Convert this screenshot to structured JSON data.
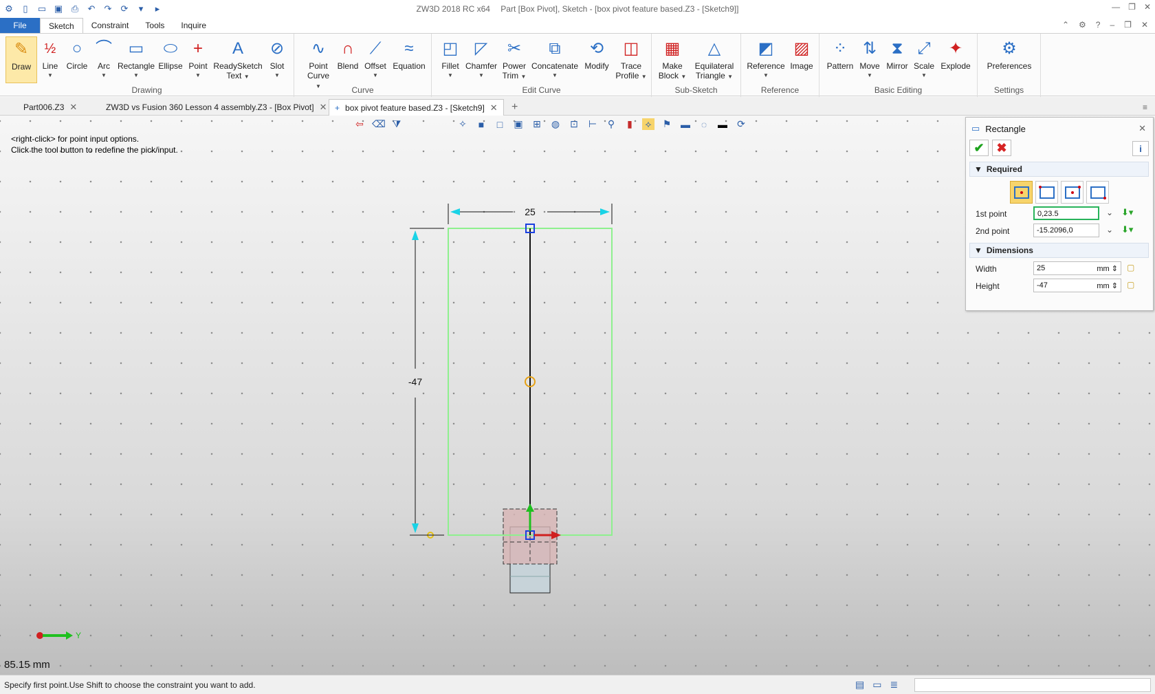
{
  "titlebar": {
    "app": "ZW3D 2018 RC x64",
    "doc": "Part [Box Pivot],  Sketch - [box pivot feature based.Z3 - [Sketch9]]"
  },
  "menus": {
    "file": "File",
    "tabs": [
      "Sketch",
      "Constraint",
      "Tools",
      "Inquire"
    ]
  },
  "ribbon": {
    "groups": {
      "drawing": "Drawing",
      "curve": "Curve",
      "edit_curve": "Edit Curve",
      "sub_sketch": "Sub-Sketch",
      "reference": "Reference",
      "basic_editing": "Basic Editing",
      "settings": "Settings"
    },
    "buttons": {
      "draw": "Draw",
      "line": "Line",
      "circle": "Circle",
      "arc": "Arc",
      "rectangle": "Rectangle",
      "ellipse": "Ellipse",
      "point": "Point",
      "readysketch_text_1": "ReadySketch",
      "readysketch_text_2": "Text",
      "slot": "Slot",
      "point_curve_1": "Point",
      "point_curve_2": "Curve",
      "blend": "Blend",
      "offset": "Offset",
      "equation": "Equation",
      "fillet": "Fillet",
      "chamfer": "Chamfer",
      "power_trim_1": "Power",
      "power_trim_2": "Trim",
      "concatenate": "Concatenate",
      "modify": "Modify",
      "trace_profile_1": "Trace",
      "trace_profile_2": "Profile",
      "make_block_1": "Make",
      "make_block_2": "Block",
      "equilateral_1": "Equilateral",
      "equilateral_2": "Triangle",
      "reference": "Reference",
      "image": "Image",
      "pattern": "Pattern",
      "move": "Move",
      "mirror": "Mirror",
      "scale": "Scale",
      "explode": "Explode",
      "preferences": "Preferences"
    }
  },
  "doc_tabs": [
    {
      "label": "Part006.Z3"
    },
    {
      "label": "ZW3D vs Fusion 360 Lesson 4 assembly.Z3 - [Box Pivot]"
    },
    {
      "label": "box pivot feature based.Z3 - [Sketch9]"
    }
  ],
  "viewport": {
    "hint_line1": "<right-click> for point input options.",
    "hint_line2": "Click the tool button to redefine the pick/input.",
    "dim_width": "25",
    "dim_height": "-47",
    "axis_y_label": "Y",
    "mm_readout": "85.15 mm"
  },
  "panel": {
    "title": "Rectangle",
    "required_label": "Required",
    "first_point_label": "1st point",
    "first_point_value": "0,23.5",
    "second_point_label": "2nd point",
    "second_point_value": "-15.2096,0",
    "dimensions_label": "Dimensions",
    "width_label": "Width",
    "width_value": "25",
    "height_label": "Height",
    "height_value": "-47",
    "unit": "mm"
  },
  "status": {
    "text": "Specify first point.Use Shift to choose the constraint you want to add."
  },
  "colors": {
    "accent_blue": "#2b6fc5",
    "sketch_green": "#8ef08e",
    "dimension_cyan": "#19d3e6",
    "active_highlight": "#f7d46b"
  }
}
